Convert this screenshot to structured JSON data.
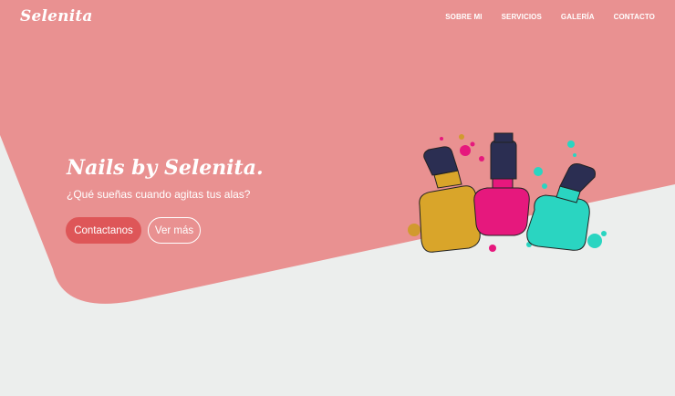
{
  "colors": {
    "hero_pink": "#e99191",
    "background": "#eceeed",
    "primary_button": "#de5658"
  },
  "nav": {
    "brand": "Selenita",
    "links": [
      "SOBRE MI",
      "SERVICIOS",
      "GALERÍA",
      "CONTACTO"
    ]
  },
  "hero": {
    "title": "Nails by Selenita.",
    "subtitle": "¿Qué sueñas cuando agitas tus alas?",
    "primary_button": "Contactanos",
    "secondary_button": "Ver más"
  },
  "illustration": {
    "icon": "nail-polish-bottles-icon"
  }
}
